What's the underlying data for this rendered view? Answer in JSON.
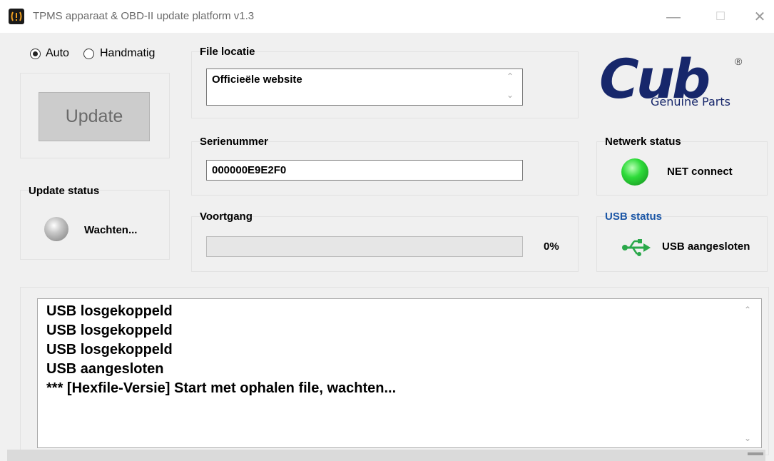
{
  "window": {
    "title": "TPMS apparaat & OBD-II update platform v1.3",
    "icon": "tpms-warning-icon",
    "minimize_glyph": "—",
    "maximize_glyph": "☐",
    "close_glyph": "✕"
  },
  "mode": {
    "auto_label": "Auto",
    "manual_label": "Handmatig",
    "selected": "auto"
  },
  "update_button": {
    "label": "Update"
  },
  "update_status": {
    "title": "Update status",
    "text": "Wachten..."
  },
  "file_location": {
    "title": "File locatie",
    "value": "Officieële website"
  },
  "serial": {
    "title": "Serienummer",
    "value": "000000E9E2F0"
  },
  "progress": {
    "title": "Voortgang",
    "percent_text": "0%",
    "value": 0
  },
  "logo": {
    "brand": "Cub",
    "tagline": "Genuine Parts",
    "registered": "®",
    "color": "#17276b"
  },
  "network_status": {
    "title": "Netwerk status",
    "text": "NET connect",
    "indicator_color": "#1ecb2c"
  },
  "usb_status": {
    "title": "USB status",
    "text": "USB aangesloten",
    "title_color": "#1b56a6",
    "icon_color": "#2aa84a"
  },
  "log": {
    "lines": [
      "USB losgekoppeld",
      "USB losgekoppeld",
      "USB losgekoppeld",
      "USB aangesloten",
      "*** [Hexfile-Versie] Start met ophalen file, wachten..."
    ]
  }
}
